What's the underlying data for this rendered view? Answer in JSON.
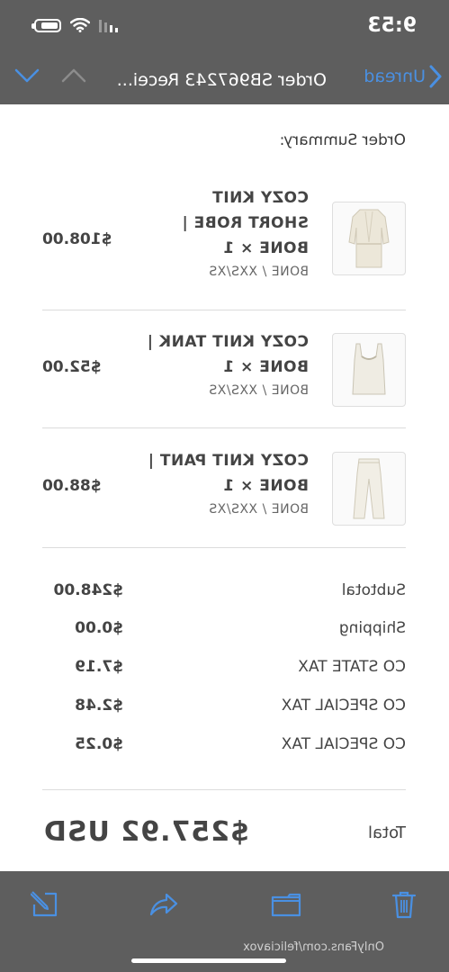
{
  "status_bar": {
    "time": "9:53"
  },
  "nav": {
    "back_label": "Unread",
    "title": "Order SB967243 Recei..."
  },
  "order": {
    "summary_title": "Order Summary:",
    "items": [
      {
        "name_lines": [
          "COZY KNIT",
          "SHORT ROBE |",
          "BONE × 1"
        ],
        "variant": "BONE / XXS/XS",
        "price": "$108.00"
      },
      {
        "name_lines": [
          "COZY KNIT TANK |",
          "BONE × 1"
        ],
        "variant": "BONE / XXS/XS",
        "price": "$52.00"
      },
      {
        "name_lines": [
          "COZY KNIT PANT |",
          "BONE × 1"
        ],
        "variant": "BONE / XXS/XS",
        "price": "$88.00"
      }
    ],
    "summary": [
      {
        "label": "Subtotal",
        "value": "$248.00"
      },
      {
        "label": "Shipping",
        "value": "$0.00"
      },
      {
        "label": "CO STATE TAX",
        "value": "$7.19"
      },
      {
        "label": "CO SPECIAL TAX",
        "value": "$2.48"
      },
      {
        "label": "CO SPECIAL TAX",
        "value": "$0.25"
      }
    ],
    "total_label": "Total",
    "total_value": "$257.92 USD"
  },
  "toolbar": {
    "icons": [
      "trash-icon",
      "folder-icon",
      "reply-icon",
      "compose-icon"
    ]
  },
  "watermark": "OnlyFans.com/feliciavox",
  "colors": {
    "accent": "#4a90e2",
    "bar": "#5e5e5e",
    "text": "#444444"
  }
}
